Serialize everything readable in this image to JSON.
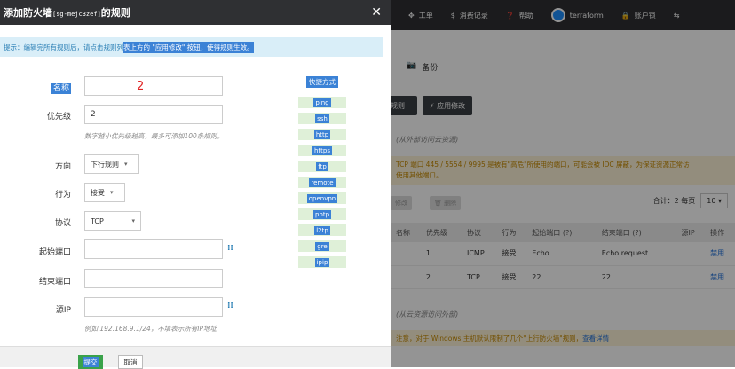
{
  "modal": {
    "title_prefix": "添加防火墙",
    "title_id": "[sg-mejc3zef]",
    "title_suffix": "的规则",
    "tip_prefix": "提示：编辑完所有规则后，请点击规则列",
    "tip_highlight": "表上方的 \"应用修改\" 按钮，使得规则生效。",
    "form": {
      "name_label": "名称",
      "name_value": "2",
      "priority_label": "优先级",
      "priority_value": "2",
      "priority_help": "数字越小优先级越高，最多可添加100条规则。",
      "direction_label": "方向",
      "direction_value": "下行规则",
      "action_label": "行为",
      "action_value": "接受",
      "protocol_label": "协议",
      "protocol_value": "TCP",
      "start_port_label": "起始端口",
      "end_port_label": "结束端口",
      "source_ip_label": "源IP",
      "source_ip_help": "例如 192.168.9.1/24，不填表示所有IP地址"
    },
    "quick": {
      "title": "快捷方式",
      "items": [
        "ping",
        "ssh",
        "http",
        "https",
        "ftp",
        "remote",
        "openvpn",
        "pptp",
        "l2tp",
        "gre",
        "ipip"
      ]
    },
    "footer": {
      "submit_label": "提交",
      "cancel_label": "取消"
    }
  },
  "background": {
    "nav": {
      "ticket": "工单",
      "billing": "消费记录",
      "help": "帮助",
      "project": "terraform",
      "account": "账户锁"
    },
    "backup_tab": "备份",
    "add_rule_btn": "规则",
    "apply_btn": "应用修改",
    "apply_marker": "1",
    "inbound_title": "(从外部访问云资源)",
    "warning_line1": "TCP 端口 445 / 5554 / 9995 是被有\"高危\"所使用的端口，可能会被 IDC 屏蔽，为保证资源正常访",
    "warning_line2": "使用其他端口。",
    "edit_btn": "修改",
    "delete_btn": "删除",
    "pager_text": "合计：2  每页",
    "page_size": "10",
    "table": {
      "headers": [
        "名称",
        "优先级",
        "协议",
        "行为",
        "起始端口 (?)",
        "结束端口 (?)",
        "源IP",
        "操作"
      ],
      "rows": [
        [
          "",
          "1",
          "ICMP",
          "接受",
          "Echo",
          "Echo request",
          "",
          "禁用"
        ],
        [
          "",
          "2",
          "TCP",
          "接受",
          "22",
          "22",
          "",
          "禁用"
        ]
      ]
    },
    "outbound_title": "(从云资源访问外部)",
    "outbound_warning": "注意，对于 Windows 主机默认限制了几个\"上行防火墙\"规则，",
    "outbound_link": "查看详情"
  }
}
